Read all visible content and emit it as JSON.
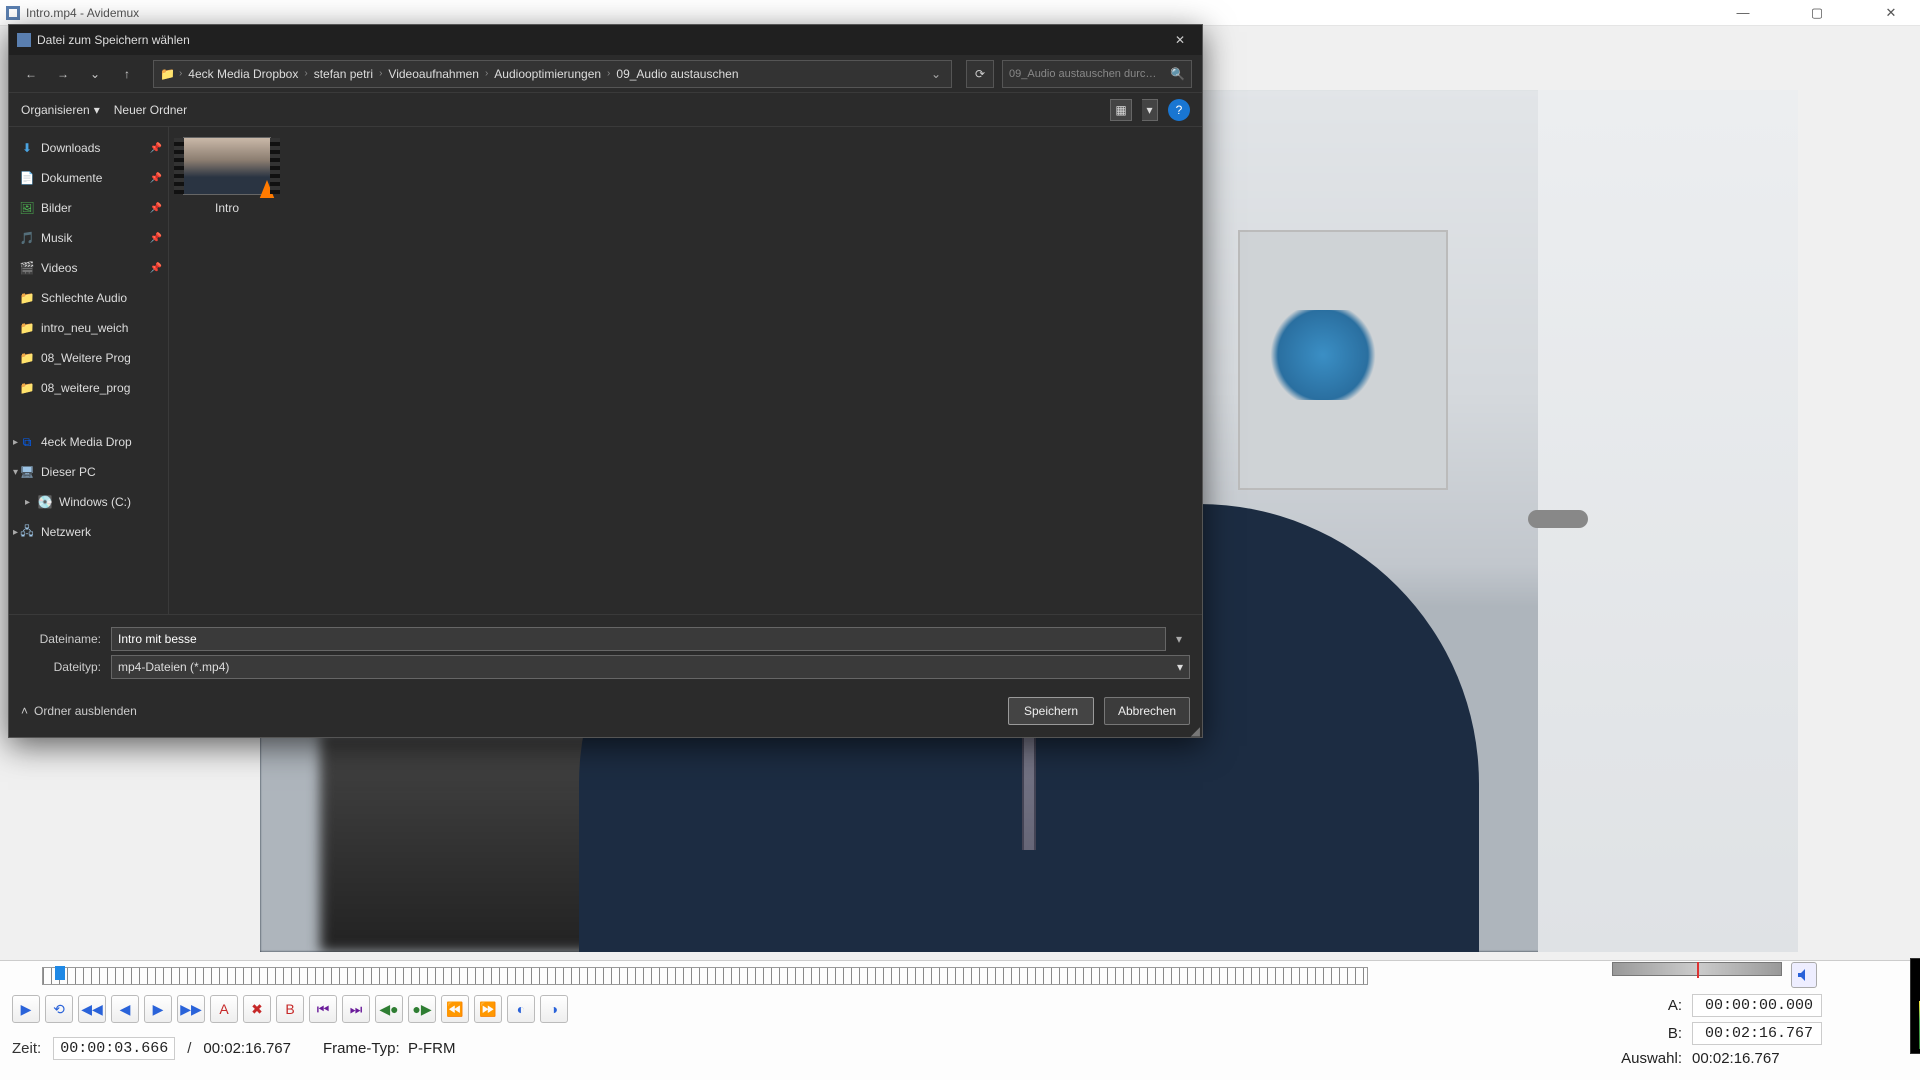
{
  "app": {
    "title": "Intro.mp4 - Avidemux",
    "window_controls": {
      "min": "—",
      "max": "▢",
      "close": "✕"
    }
  },
  "dialog": {
    "title": "Datei zum Speichern wählen",
    "breadcrumbs": [
      "4eck Media Dropbox",
      "stefan petri",
      "Videoaufnahmen",
      "Audiooptimierungen",
      "09_Audio austauschen"
    ],
    "search_placeholder": "09_Audio austauschen durc…",
    "organize": "Organisieren",
    "new_folder": "Neuer Ordner",
    "sidebar": [
      {
        "label": "Downloads",
        "icon": "download-icon",
        "pinned": true
      },
      {
        "label": "Dokumente",
        "icon": "document-icon",
        "pinned": true
      },
      {
        "label": "Bilder",
        "icon": "pictures-icon",
        "pinned": true
      },
      {
        "label": "Musik",
        "icon": "music-icon",
        "pinned": true
      },
      {
        "label": "Videos",
        "icon": "videos-icon",
        "pinned": true
      },
      {
        "label": "Schlechte Audio",
        "icon": "folder-icon"
      },
      {
        "label": "intro_neu_weich",
        "icon": "folder-icon"
      },
      {
        "label": "08_Weitere Prog",
        "icon": "folder-icon"
      },
      {
        "label": "08_weitere_prog",
        "icon": "folder-icon"
      }
    ],
    "tree": [
      {
        "label": "4eck Media Drop",
        "icon": "dropbox-icon",
        "expander": "▸"
      },
      {
        "label": "Dieser PC",
        "icon": "pc-icon",
        "expander": "▾"
      },
      {
        "label": "Windows (C:)",
        "icon": "disk-icon",
        "indent": true,
        "expander": "▸"
      },
      {
        "label": "Netzwerk",
        "icon": "network-icon",
        "expander": "▸"
      }
    ],
    "files": [
      {
        "name": "Intro"
      }
    ],
    "filename_label": "Dateiname:",
    "filename_value": "Intro mit besse",
    "filetype_label": "Dateityp:",
    "filetype_value": "mp4-Dateien (*.mp4)",
    "hide_folders": "Ordner ausblenden",
    "save": "Speichern",
    "cancel": "Abbrechen"
  },
  "timeline": {
    "time_label": "Zeit:",
    "time_value": "00:00:03.666",
    "duration": "00:02:16.767",
    "frame_label": "Frame-Typ:",
    "frame_value": "P-FRM",
    "a_label": "A:",
    "a_value": "00:00:00.000",
    "b_label": "B:",
    "b_value": "00:02:16.767",
    "sel_label": "Auswahl:",
    "sel_value": "00:02:16.767"
  }
}
